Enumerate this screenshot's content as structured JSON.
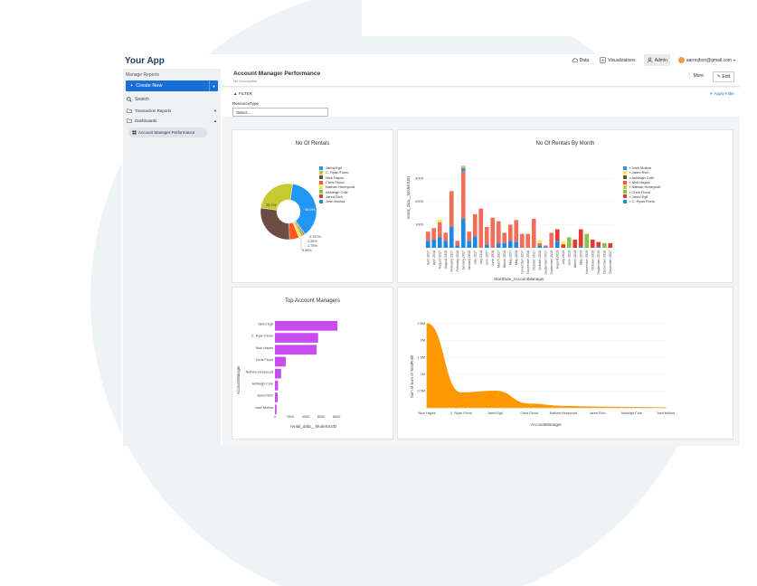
{
  "app": {
    "brand": "Your App"
  },
  "nav": {
    "data": "Data",
    "visualizations": "Visualizations",
    "admin": "Admin",
    "user": "aaronjhon@gmail.com"
  },
  "sidebar": {
    "header": "Manage Reports",
    "create_label": "Create New",
    "search_label": "Search",
    "items": [
      {
        "label": "Transaction Reports",
        "arrow": "▼"
      },
      {
        "label": "Dashboards",
        "arrow": "▲"
      }
    ],
    "child": "Account Manager Performance"
  },
  "page": {
    "title": "Account Manager Performance",
    "description": "No Description",
    "more": "More",
    "edit": "Edit"
  },
  "filter": {
    "title": "FILTER",
    "apply": "Apply Filter",
    "resource_label": "ResourceType",
    "select_placeholder": "Select..."
  },
  "colors": {
    "blue": "#2196f3",
    "yellow": "#c8c830",
    "brown": "#6d4c41",
    "orange": "#ff5722",
    "lightyellow": "#ffeb3b",
    "green": "#8bc34a",
    "red": "#e53935",
    "cornflower": "#1e88e5",
    "purple": "#c94cf0",
    "amber": "#ff9800",
    "salmon": "#f06e5a"
  },
  "chart_data": [
    {
      "type": "pie",
      "title": "No Of Rentals",
      "labels": [
        "Jared Egli",
        "C. Ryan Florio",
        "Nick Hayes",
        "Chris Flood",
        "Nathan Honeycutt",
        "Ashleigh Cole",
        "Jared Rich",
        "Josh Molina"
      ],
      "values": [
        38.0,
        25.7,
        28.1,
        5.55,
        1.75,
        1.26,
        0.757,
        0.5
      ],
      "slice_labels": [
        "38.0%",
        "25.7%",
        "5.55%",
        "1.75%",
        "1.26%",
        "0.757%"
      ],
      "legend_position": "right"
    },
    {
      "type": "bar",
      "title": "No Of Rentals By Month",
      "xlabel": "StartDate_AccountManager",
      "ylabel": "rental_data__ModelUUID",
      "y_ticks": [
        "1000",
        "2000",
        "3000"
      ],
      "ylim": [
        0,
        3600
      ],
      "categories": [
        "April 2017",
        "April 2018",
        "August 2017",
        "August 2018",
        "February 2017",
        "February 2018",
        "January 2017",
        "January 2018",
        "July 2017",
        "July 2018",
        "June 2017",
        "June 2018",
        "March 2017",
        "March 2018",
        "May 2017",
        "May 2018",
        "November 2017",
        "November 2018",
        "October 2017",
        "October 2018",
        "September 2017",
        "September 2018",
        "August 2019",
        "July 2019",
        "June 2019",
        "March 2019",
        "May 2019",
        "November 2019",
        "October 2019",
        "September 2019",
        "December 2018",
        "December 2017"
      ],
      "series": [
        {
          "name": "r Josh Molina",
          "values": [
            0,
            0,
            0,
            0,
            0,
            0,
            0,
            0,
            0,
            0,
            0,
            0,
            0,
            0,
            0,
            0,
            0,
            0,
            0,
            0,
            0,
            0,
            0,
            0,
            0,
            0,
            0,
            0,
            0,
            0,
            0,
            0
          ]
        },
        {
          "name": "r Jared Rich",
          "values": [
            0,
            0,
            0,
            0,
            0,
            0,
            0,
            0,
            0,
            0,
            0,
            0,
            0,
            0,
            0,
            0,
            0,
            0,
            0,
            0,
            0,
            0,
            0,
            0,
            0,
            0,
            0,
            0,
            0,
            0,
            0,
            0
          ]
        },
        {
          "name": "r Ashleigh Cole",
          "values": [
            0,
            0,
            0,
            0,
            0,
            0,
            0,
            0,
            0,
            0,
            0,
            0,
            0,
            0,
            0,
            0,
            0,
            0,
            0,
            0,
            0,
            0,
            0,
            0,
            0,
            0,
            0,
            0,
            0,
            0,
            0,
            0
          ]
        },
        {
          "name": "r Nick Hayes",
          "values": [
            0,
            0,
            0,
            0,
            0,
            0,
            0,
            0,
            0,
            0,
            0,
            0,
            0,
            0,
            0,
            0,
            0,
            0,
            0,
            0,
            0,
            0,
            0,
            0,
            0,
            0,
            0,
            0,
            0,
            0,
            0,
            0
          ]
        },
        {
          "name": "r Nathan Honeycutt",
          "values": [
            0,
            0,
            0,
            0,
            0,
            0,
            0,
            0,
            0,
            0,
            0,
            0,
            0,
            0,
            0,
            0,
            0,
            0,
            0,
            0,
            0,
            0,
            0,
            0,
            0,
            0,
            0,
            0,
            0,
            0,
            0,
            0
          ]
        },
        {
          "name": "r Chris Flood",
          "values": [
            0,
            0,
            0,
            0,
            0,
            0,
            0,
            0,
            0,
            0,
            0,
            0,
            0,
            0,
            0,
            0,
            0,
            0,
            0,
            0,
            0,
            0,
            0,
            0,
            0,
            0,
            0,
            0,
            0,
            0,
            0,
            0
          ]
        },
        {
          "name": "r Jared Egli",
          "values": [
            0,
            0,
            0,
            0,
            0,
            0,
            0,
            0,
            0,
            0,
            0,
            0,
            0,
            0,
            0,
            0,
            0,
            0,
            0,
            0,
            0,
            0,
            0,
            0,
            0,
            0,
            0,
            0,
            0,
            0,
            0,
            0
          ]
        },
        {
          "name": "r C. Ryan Florio",
          "values": [
            0,
            0,
            0,
            0,
            0,
            0,
            0,
            0,
            0,
            0,
            0,
            0,
            0,
            0,
            0,
            0,
            0,
            0,
            0,
            0,
            0,
            0,
            0,
            0,
            0,
            0,
            0,
            0,
            0,
            0,
            0,
            0
          ]
        }
      ],
      "totals": [
        700,
        850,
        1100,
        650,
        2450,
        300,
        3300,
        700,
        1450,
        1700,
        900,
        1300,
        1150,
        650,
        1000,
        1200,
        600,
        600,
        1250,
        200,
        100,
        650,
        800,
        150,
        450,
        350,
        800,
        600,
        350,
        250,
        200,
        200
      ],
      "blue_part": [
        300,
        350,
        450,
        300,
        900,
        100,
        1250,
        300,
        500,
        0,
        150,
        0,
        200,
        200,
        300,
        250,
        0,
        0,
        0,
        100,
        50,
        0,
        300,
        0,
        0,
        0,
        50,
        0,
        0,
        50,
        0,
        0
      ],
      "legend_position": "right"
    },
    {
      "type": "bar",
      "orientation": "horizontal",
      "title": "Top Account Managers",
      "xlabel": "rental_data__ModelUUID",
      "ylabel": "AccountManager",
      "categories": [
        "Jared Egli",
        "C. Ryan Florio",
        "Nick Hayes",
        "Chris Flood",
        "Nathan Honeycutt",
        "Ashleigh Cole",
        "Jared Rich",
        "Josh Molina"
      ],
      "values": [
        8100,
        5600,
        5400,
        1400,
        800,
        400,
        350,
        200
      ],
      "x_ticks": [
        "0",
        "2000",
        "4000",
        "6000",
        "8000"
      ],
      "xlim": [
        0,
        8800
      ]
    },
    {
      "type": "area",
      "title": "",
      "xlabel": "AccountManager",
      "ylabel": "Sum of Sum of TotalProfit",
      "categories": [
        "Nick Hayes",
        "C. Ryan Florio",
        "Jared Egli",
        "Chris Flood",
        "Nathan Honeycutt",
        "Jared Rich",
        "Ashleigh Cole",
        "Josh Molina"
      ],
      "values": [
        2.5,
        0.45,
        0.5,
        0.12,
        0.05,
        0.03,
        0.02,
        0.01
      ],
      "y_ticks": [
        "0.5M",
        "1M",
        "1.5M",
        "2M",
        "2.5M"
      ],
      "ylim": [
        0,
        2.6
      ]
    }
  ]
}
